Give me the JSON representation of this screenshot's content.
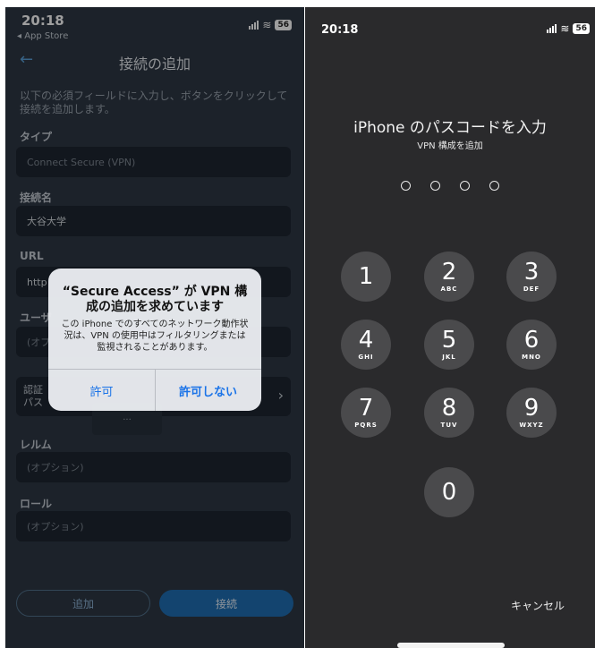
{
  "left": {
    "status": {
      "time": "20:18",
      "back_app": "◂ App Store",
      "battery": "56"
    },
    "nav": {
      "back_icon": "←",
      "title": "接続の追加"
    },
    "intro": "以下の必須フィールドに入力し、ボタンをクリックして接続を追加します。",
    "type": {
      "label": "タイプ",
      "value": "Connect Secure (VPN)"
    },
    "conn_name": {
      "label": "接続名",
      "value": "大谷大学"
    },
    "url": {
      "label": "URL",
      "value": "http"
    },
    "user": {
      "label": "ユーザ",
      "placeholder": "(オプ"
    },
    "auth": {
      "label_line1": "認証",
      "label_line2": "パス",
      "inner": "...",
      "chevron": "›"
    },
    "realm": {
      "label": "レルム",
      "placeholder": "(オプション)"
    },
    "role": {
      "label": "ロール",
      "placeholder": "(オプション)"
    },
    "buttons": {
      "add": "追加",
      "connect": "接続"
    },
    "alert": {
      "title": "“Secure Access” が VPN 構成の追加を求めています",
      "body": "この iPhone でのすべてのネットワーク動作状況は、VPN の使用中はフィルタリングまたは監視されることがあります。",
      "allow": "許可",
      "deny": "許可しない"
    }
  },
  "right": {
    "status": {
      "time": "20:18",
      "battery": "56"
    },
    "title": "iPhone のパスコードを入力",
    "subtitle": "VPN 構成を追加",
    "keys": [
      {
        "num": "1",
        "letters": ""
      },
      {
        "num": "2",
        "letters": "ABC"
      },
      {
        "num": "3",
        "letters": "DEF"
      },
      {
        "num": "4",
        "letters": "GHI"
      },
      {
        "num": "5",
        "letters": "JKL"
      },
      {
        "num": "6",
        "letters": "MNO"
      },
      {
        "num": "7",
        "letters": "PQRS"
      },
      {
        "num": "8",
        "letters": "TUV"
      },
      {
        "num": "9",
        "letters": "WXYZ"
      },
      {
        "num": "0",
        "letters": ""
      }
    ],
    "cancel": "キャンセル"
  }
}
